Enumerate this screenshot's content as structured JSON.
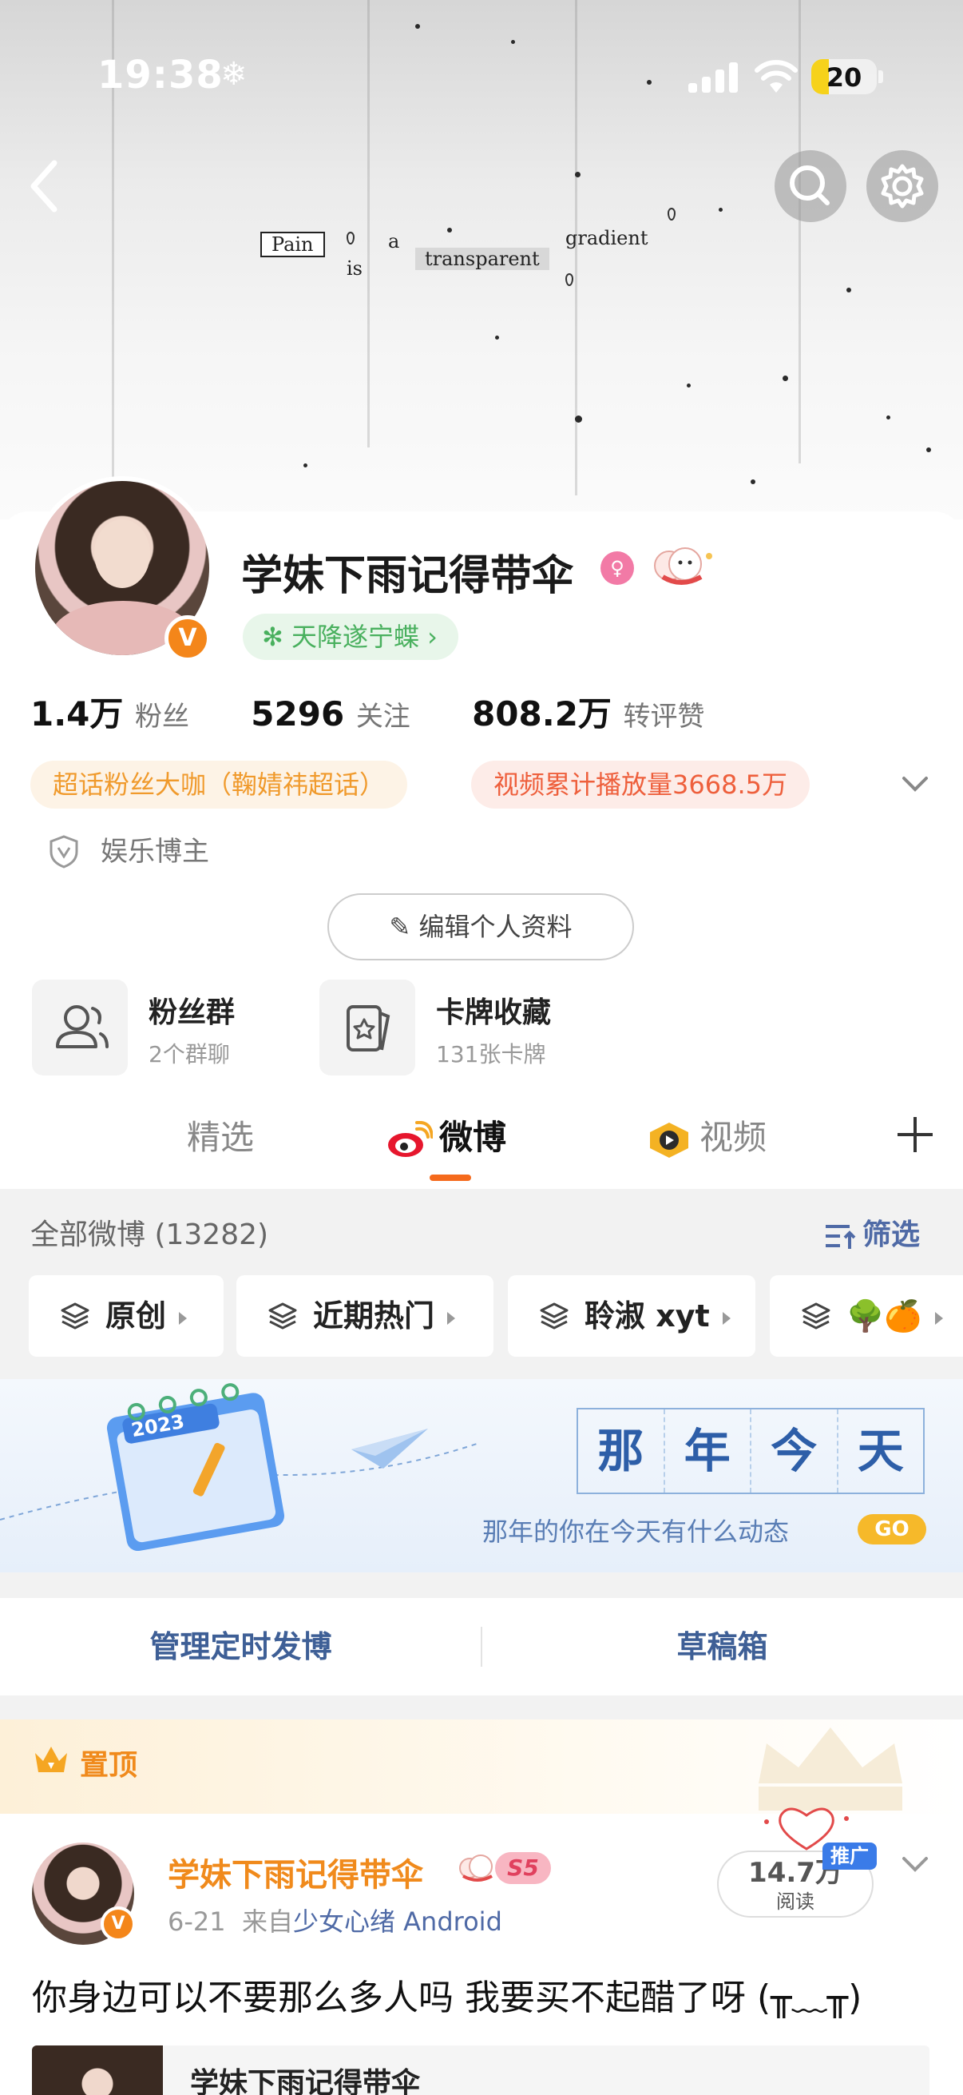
{
  "status_bar": {
    "time": "19:38",
    "weather": "❄",
    "battery": "20"
  },
  "cover": {
    "words": [
      "Pain",
      "is",
      "a",
      "transparent",
      "gradient"
    ]
  },
  "profile": {
    "name": "学妹下雨记得带伞",
    "verified_badge": "V",
    "super_topic": "天降遂宁蝶",
    "stats": [
      {
        "value": "1.4万",
        "label": "粉丝"
      },
      {
        "value": "5296",
        "label": "关注"
      },
      {
        "value": "808.2万",
        "label": "转评赞"
      }
    ],
    "tags": [
      "超话粉丝大咖（鞠婧祎超话）",
      "视频累计播放量3668.5万"
    ],
    "role": "娱乐博主",
    "edit_button": "编辑个人资料",
    "features": [
      {
        "title": "粉丝群",
        "subtitle": "2个群聊",
        "icon": "people-icon"
      },
      {
        "title": "卡牌收藏",
        "subtitle": "131张卡牌",
        "icon": "card-icon"
      }
    ]
  },
  "tabs": [
    {
      "label": "精选",
      "active": false
    },
    {
      "label": "微博",
      "active": true
    },
    {
      "label": "视频",
      "active": false
    }
  ],
  "feed": {
    "header": "全部微博 (13282)",
    "filter": "筛选",
    "chips": [
      "原创",
      "近期热门",
      "聆淑 xyt",
      "🌳🍊"
    ]
  },
  "banner": {
    "title_chars": [
      "那",
      "年",
      "今",
      "天"
    ],
    "subtitle": "那年的你在今天有什么动态",
    "go": "GO",
    "calendar_year": "2023"
  },
  "manage": {
    "scheduled": "管理定时发博",
    "drafts": "草稿箱"
  },
  "pinned_post": {
    "pin_label": "置顶",
    "author": "学妹下雨记得带伞",
    "level_badge": "S5",
    "date": "6-21",
    "source_prefix": "来自",
    "source": "少女心绪 Android",
    "reads": "14.7万",
    "reads_label": "阅读",
    "promo": "推广",
    "text": "你身边可以不要那么多人吗 我要买不起醋了呀 (╥﹏╥)",
    "quote_title": "学妹下雨记得带伞"
  },
  "colors": {
    "accent": "#f56a1c",
    "link": "#4f6aa6",
    "gold": "#f08a1c"
  }
}
